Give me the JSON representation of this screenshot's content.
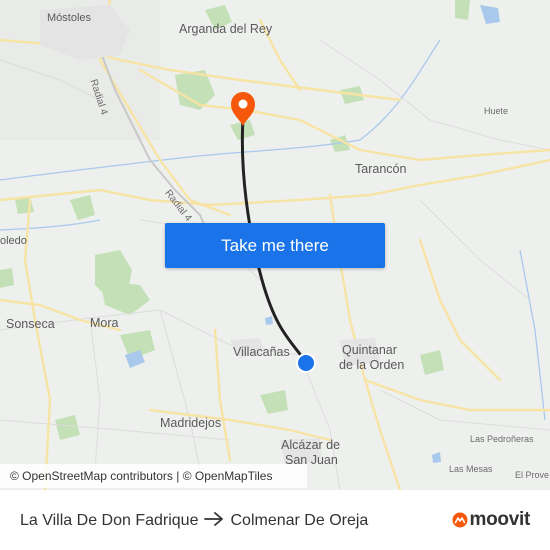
{
  "map": {
    "places": {
      "mostoles": "Móstoles",
      "arganda": "Arganda del Rey",
      "huete": "Huete",
      "tarancon": "Tarancón",
      "toledo": "oledo",
      "sonseca": "Sonseca",
      "mora": "Mora",
      "villacanas": "Villacañas",
      "quintanar": "Quintanar",
      "quintanar2": "de la Orden",
      "madridejos": "Madridejos",
      "alcazar": "Alcázar de",
      "alcazar2": "San Juan",
      "pedronieras": "Las Pedroñeras",
      "mesas": "Las Mesas",
      "provencio": "El Prove"
    },
    "roads": {
      "radial4_a": "Radial 4",
      "radial4_b": "Radial 4"
    },
    "destination_marker_icon": "location-pin-icon",
    "origin_marker_icon": "current-location-dot-icon",
    "colors": {
      "route_line": "#222222",
      "destination_pin": "#f5570b",
      "origin_dot": "#1a73e8",
      "button": "#1a73e8",
      "water": "#a9c9ec",
      "green": "#c4e0b6",
      "roads": "#f7e4a5"
    }
  },
  "cta": {
    "label": "Take me there"
  },
  "attribution": {
    "text": "© OpenStreetMap contributors | © OpenMapTiles"
  },
  "footer": {
    "from": "La Villa De Don Fadrique",
    "to": "Colmenar De Oreja",
    "arrow_icon": "arrow-right-icon",
    "logo_text": "moovit",
    "logo_icon": "moovit-logo-icon"
  }
}
